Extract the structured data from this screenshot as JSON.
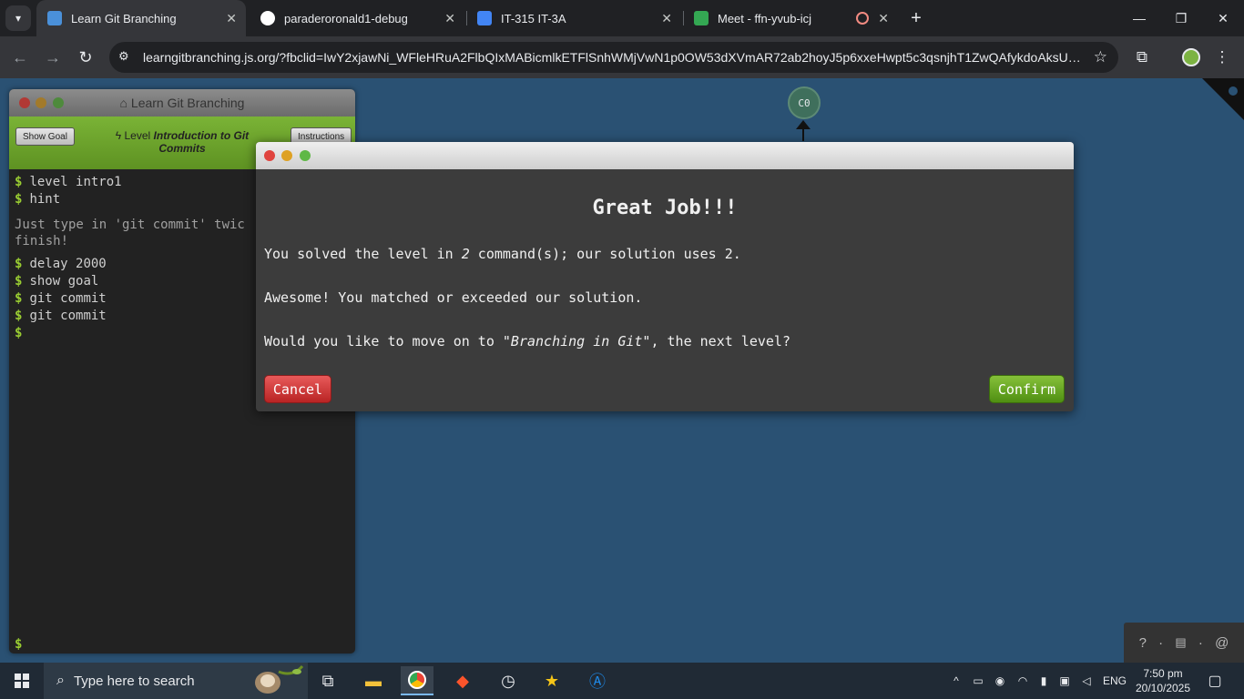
{
  "browser": {
    "tabs": [
      {
        "title": "Learn Git Branching",
        "active": true,
        "favicon_color": "#4a90d9"
      },
      {
        "title": "paraderoronald1-debug",
        "active": false,
        "favicon_color": "#ffffff"
      },
      {
        "title": "IT-315 IT-3A",
        "active": false,
        "favicon_color": "#4285f4"
      },
      {
        "title": "Meet - ffn-yvub-icj",
        "active": false,
        "favicon_color": "#34a853"
      }
    ],
    "url_host": "learngitbranching.js.org",
    "url_rest": "/?fbclid=IwY2xjawNi_WFleHRuA2FlbQIxMABicmlkETFlSnhWMjVwN1p0OW53dXVmAR72ab2hoyJ5p6xxeHwpt5c3qsnjhT1ZwQAfykdoAksUw2P..."
  },
  "terminal": {
    "title": "Learn Git Branching",
    "show_goal_label": "Show Goal",
    "instructions_label": "Instructions",
    "level_prefix": "Level",
    "level_name": "Introduction to Git Commits",
    "prompt": "$",
    "commands_before_hint": [
      "level intro1",
      "hint"
    ],
    "hint_text": "Just type in 'git commit' twic\nfinish!",
    "commands_after_hint": [
      "delay 2000",
      "show goal",
      "git commit",
      "git commit",
      ""
    ]
  },
  "graph": {
    "commit_label": "C0"
  },
  "dialog": {
    "heading": "Great Job!!!",
    "line1_prefix": "You solved the level in ",
    "line1_count": "2",
    "line1_suffix": " command(s); our solution uses 2.",
    "line2": "Awesome! You matched or exceeded our solution.",
    "line3_prefix": "Would you like to move on to ",
    "line3_level": "\"Branching in Git\"",
    "line3_suffix": ", the next level?",
    "cancel_label": "Cancel",
    "confirm_label": "Confirm"
  },
  "help": {
    "question": "?",
    "dot": "·"
  },
  "taskbar": {
    "search_placeholder": "Type here to search",
    "language": "ENG",
    "time": "7:50 pm",
    "date": "20/10/2025"
  }
}
